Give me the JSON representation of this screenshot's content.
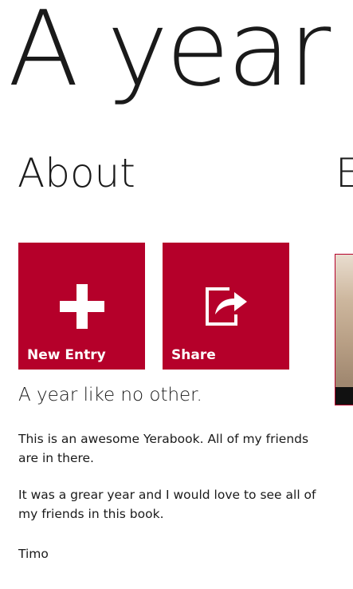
{
  "app": {
    "title": "A year"
  },
  "sections": {
    "about": "About",
    "next_partial": "E"
  },
  "tiles": {
    "new_entry": "New Entry",
    "share": "Share"
  },
  "about": {
    "headline": "A year like no other.",
    "paragraph1": "This is an awesome Yerabook. All of my friends are in there.",
    "paragraph2": "It was a grear year and I would love to see all of my friends in this book.",
    "signature": "Timo"
  },
  "colors": {
    "accent": "#b5002a",
    "text": "#1a1a1a",
    "background": "#ffffff"
  },
  "icons": {
    "new_entry": "plus-icon",
    "share": "share-icon"
  }
}
